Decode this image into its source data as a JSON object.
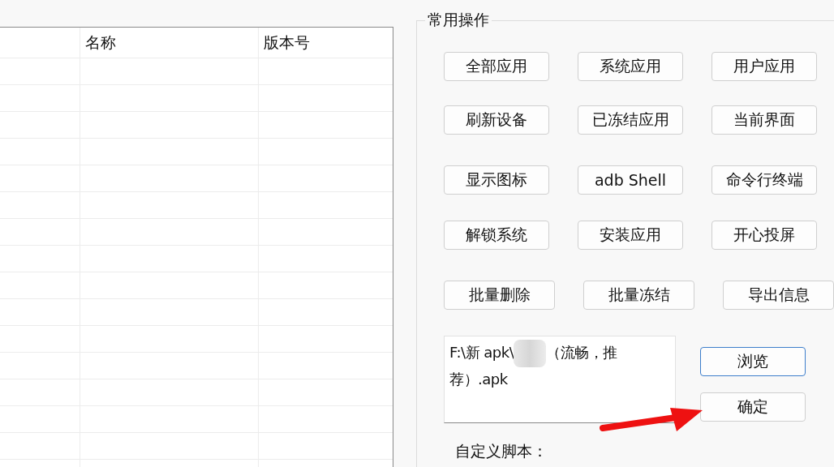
{
  "table": {
    "columns": [
      "名称",
      "版本号"
    ]
  },
  "group": {
    "title": "常用操作",
    "button_rows": [
      [
        "全部应用",
        "系统应用",
        "用户应用"
      ],
      [
        "刷新设备",
        "已冻结应用",
        "当前界面"
      ],
      [
        "显示图标",
        "adb Shell",
        "命令行终端"
      ],
      [
        "解锁系统",
        "安装应用",
        "开心投屏"
      ],
      [
        "批量删除",
        "批量冻结",
        "导出信息"
      ]
    ],
    "path_field": {
      "value_start": "F:\\新 apk\\",
      "value_end": "（流畅，推荐）.apk"
    },
    "browse_button": {
      "label": "浏览",
      "focused": true
    },
    "ok_button": {
      "label": "确定",
      "focused": false
    },
    "script_label": "自定义脚本："
  }
}
